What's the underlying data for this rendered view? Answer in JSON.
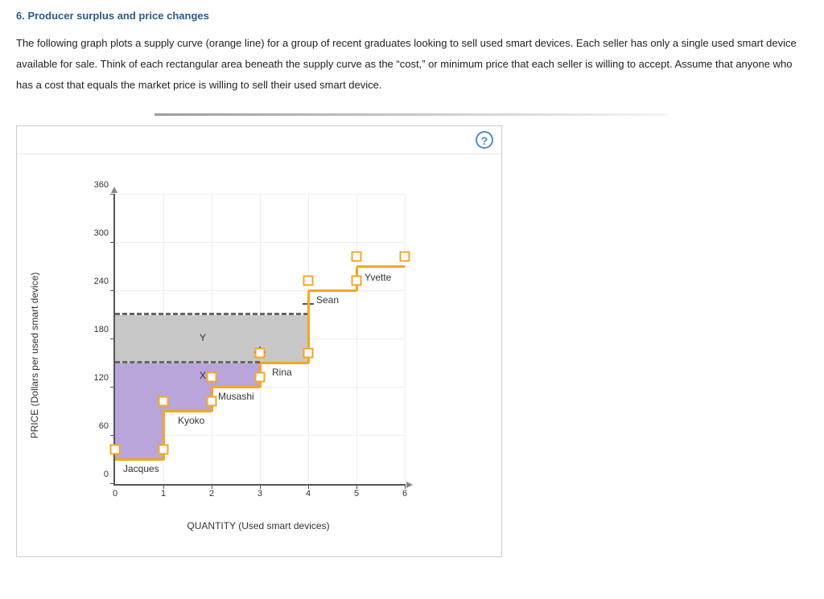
{
  "heading": "6. Producer surplus and price changes",
  "intro": "The following graph plots a supply curve (orange line) for a group of recent graduates looking to sell used smart devices. Each seller has only a single used smart device available for sale. Think of each rectangular area beneath the supply curve as the “cost,” or minimum price that each seller is willing to accept. Assume that anyone who has a cost that equals the market price is willing to sell their used smart device.",
  "help": "?",
  "axes": {
    "ylabel": "PRICE (Dollars per used smart device)",
    "xlabel": "QUANTITY (Used smart devices)",
    "yticks": [
      "0",
      "60",
      "120",
      "180",
      "240",
      "300",
      "360"
    ],
    "xticks": [
      "0",
      "1",
      "2",
      "3",
      "4",
      "5",
      "6"
    ]
  },
  "labels": {
    "jacques": "Jacques",
    "kyoko": "Kyoko",
    "musashi": "Musashi",
    "rina": "Rina",
    "sean": "Sean",
    "yvette": "Yvette",
    "X": "X",
    "Y": "Y"
  },
  "chart_data": {
    "type": "step-supply",
    "xlabel": "QUANTITY (Used smart devices)",
    "ylabel": "PRICE (Dollars per used smart device)",
    "xlim": [
      0,
      6
    ],
    "ylim": [
      0,
      360
    ],
    "sellers": [
      {
        "name": "Jacques",
        "cost": 30,
        "x_range": [
          0,
          1
        ]
      },
      {
        "name": "Kyoko",
        "cost": 90,
        "x_range": [
          1,
          2
        ]
      },
      {
        "name": "Musashi",
        "cost": 120,
        "x_range": [
          2,
          3
        ]
      },
      {
        "name": "Rina",
        "cost": 150,
        "x_range": [
          3,
          4
        ]
      },
      {
        "name": "Sean",
        "cost": 240,
        "x_range": [
          4,
          5
        ]
      },
      {
        "name": "Yvette",
        "cost": 270,
        "x_range": [
          5,
          6
        ]
      }
    ],
    "price_lines": [
      {
        "label": "lower",
        "price": 150,
        "x_end": 3,
        "marker": "X"
      },
      {
        "label": "upper",
        "price": 210,
        "x_end": 4,
        "marker": "Y"
      }
    ],
    "shaded_regions": [
      {
        "name": "X-surplus-jacques",
        "x": [
          0,
          1
        ],
        "y": [
          30,
          150
        ],
        "color": "#b9a5d9"
      },
      {
        "name": "X-surplus-kyoko",
        "x": [
          1,
          2
        ],
        "y": [
          90,
          150
        ],
        "color": "#b9a5d9"
      },
      {
        "name": "X-surplus-musashi",
        "x": [
          2,
          3
        ],
        "y": [
          120,
          150
        ],
        "color": "#b9a5d9"
      },
      {
        "name": "Y-extra",
        "x": [
          0,
          4
        ],
        "y": [
          150,
          210
        ],
        "color": "#c8c8c8"
      }
    ]
  }
}
